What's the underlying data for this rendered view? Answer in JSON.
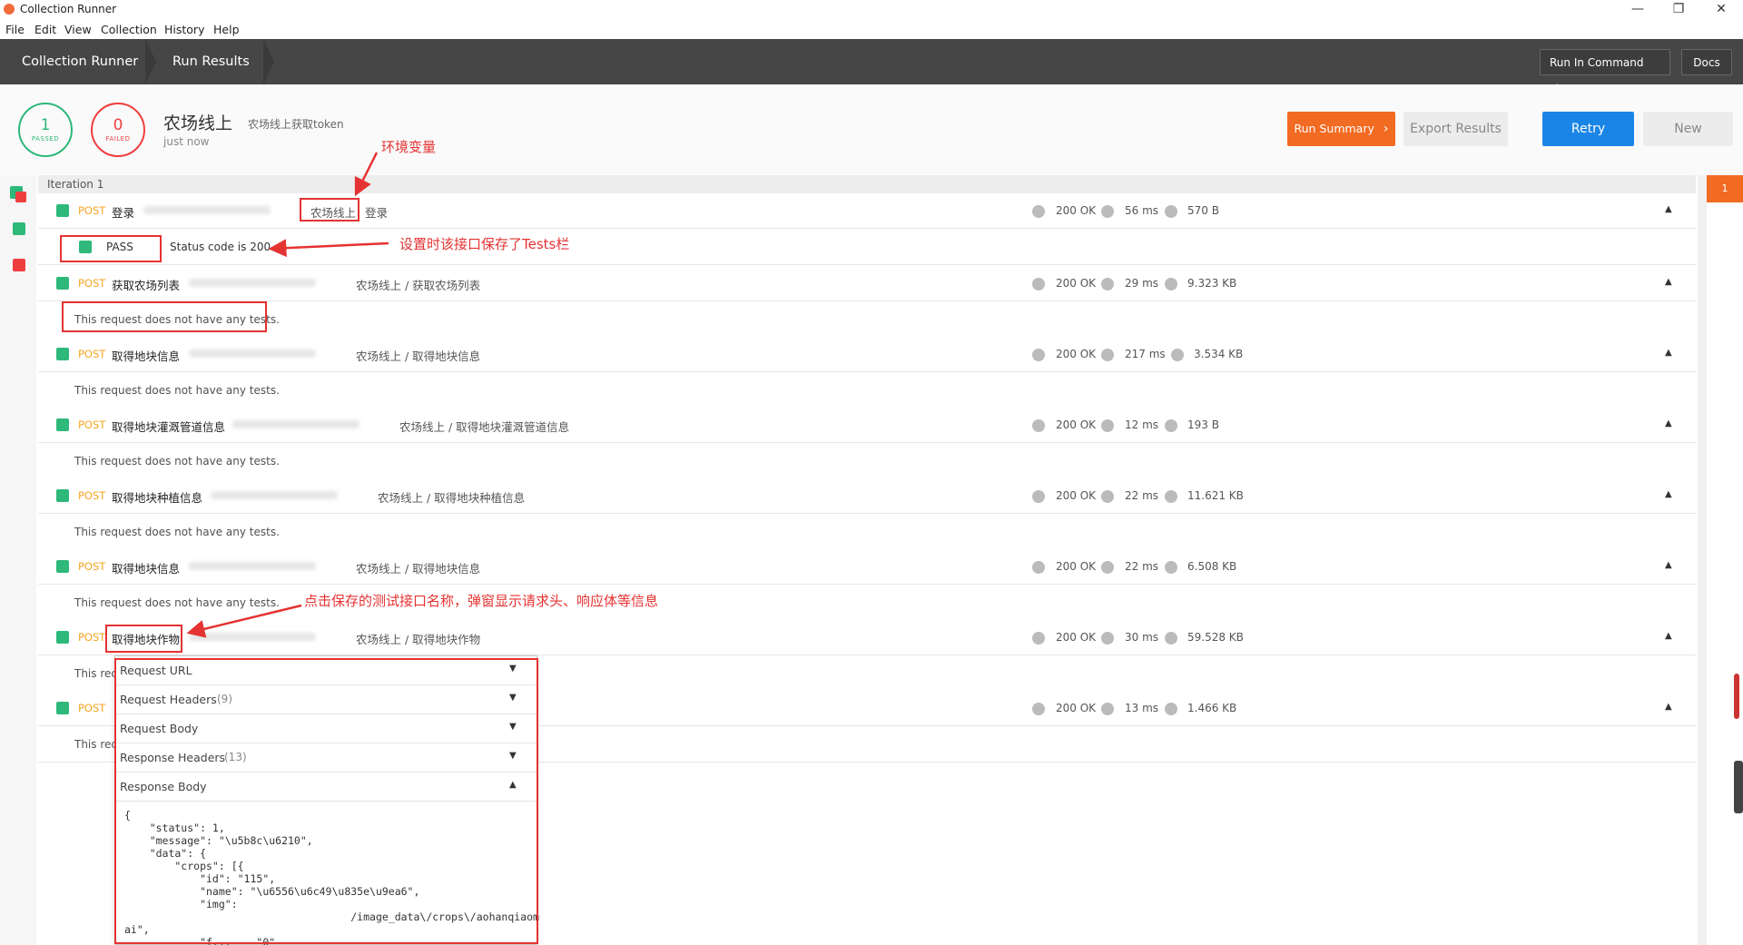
{
  "window": {
    "title": "Collection Runner",
    "controls": [
      "—",
      "❐",
      "✕"
    ]
  },
  "menu": [
    "File",
    "Edit",
    "View",
    "Collection",
    "History",
    "Help"
  ],
  "header": {
    "crumbs": [
      "Collection Runner",
      "Run Results"
    ],
    "run_cli": "Run In Command Line",
    "docs": "Docs"
  },
  "summary": {
    "passed": {
      "count": "1",
      "label": "PASSED"
    },
    "failed": {
      "count": "0",
      "label": "FAILED"
    },
    "env": "农场线上",
    "collection": "农场线上获取token",
    "time": "just now",
    "run_summary": "Run Summary",
    "export": "Export Results",
    "retry": "Retry",
    "new": "New"
  },
  "iteration": "Iteration 1",
  "requests": [
    {
      "method": "POST",
      "name": "登录",
      "path_env": "农场线上",
      "path": "登录",
      "status": "200 OK",
      "time": "56 ms",
      "size": "570 B"
    },
    {
      "method": "POST",
      "name": "获取农场列表",
      "path": "农场线上 / 获取农场列表",
      "status": "200 OK",
      "time": "29 ms",
      "size": "9.323 KB"
    },
    {
      "method": "POST",
      "name": "取得地块信息",
      "path": "农场线上 / 取得地块信息",
      "status": "200 OK",
      "time": "217 ms",
      "size": "3.534 KB"
    },
    {
      "method": "POST",
      "name": "取得地块灌溉管道信息",
      "path": "农场线上 / 取得地块灌溉管道信息",
      "status": "200 OK",
      "time": "12 ms",
      "size": "193 B"
    },
    {
      "method": "POST",
      "name": "取得地块种植信息",
      "path": "农场线上 / 取得地块种植信息",
      "status": "200 OK",
      "time": "22 ms",
      "size": "11.621 KB"
    },
    {
      "method": "POST",
      "name": "取得地块信息",
      "path": "农场线上 / 取得地块信息",
      "status": "200 OK",
      "time": "22 ms",
      "size": "6.508 KB"
    },
    {
      "method": "POST",
      "name": "取得地块作物",
      "path": "农场线上 / 取得地块作物",
      "status": "200 OK",
      "time": "30 ms",
      "size": "59.528 KB"
    },
    {
      "method": "POST",
      "name": "",
      "path": "",
      "status": "200 OK",
      "time": "13 ms",
      "size": "1.466 KB"
    }
  ],
  "tests": {
    "pass_label": "PASS",
    "pass_text": "Status code is 200",
    "no_tests": "This request does not have any tests.",
    "no_tests_short": "This rec"
  },
  "annotations": {
    "env_var": "环境变量",
    "tests_saved": "设置时该接口保存了Tests栏",
    "click_info": "点击保存的测试接口名称，弹窗显示请求头、响应体等信息"
  },
  "popup": {
    "sections": [
      {
        "label": "Request URL",
        "count": ""
      },
      {
        "label": "Request Headers",
        "count": "(9)"
      },
      {
        "label": "Request Body",
        "count": ""
      },
      {
        "label": "Response Headers",
        "count": "(13)"
      },
      {
        "label": "Response Body",
        "count": ""
      }
    ],
    "response_body": "{\n    \"status\": 1,\n    \"message\": \"\\u5b8c\\u6210\",\n    \"data\": {\n        \"crops\": [{\n            \"id\": \"115\",\n            \"name\": \"\\u6556\\u6c49\\u835e\\u9ea6\",\n            \"img\":\n                                    /image_data\\/crops\\/aohanqiaom\nai\",\n            \"f...    \"0\""
  },
  "right_badge": "1",
  "colors": {
    "accent": "#f26b22",
    "retry": "#1a85e6",
    "pass": "#2eb87a",
    "fail": "#ef3e3e",
    "method": "#f5a623",
    "annotation": "#e53232"
  }
}
